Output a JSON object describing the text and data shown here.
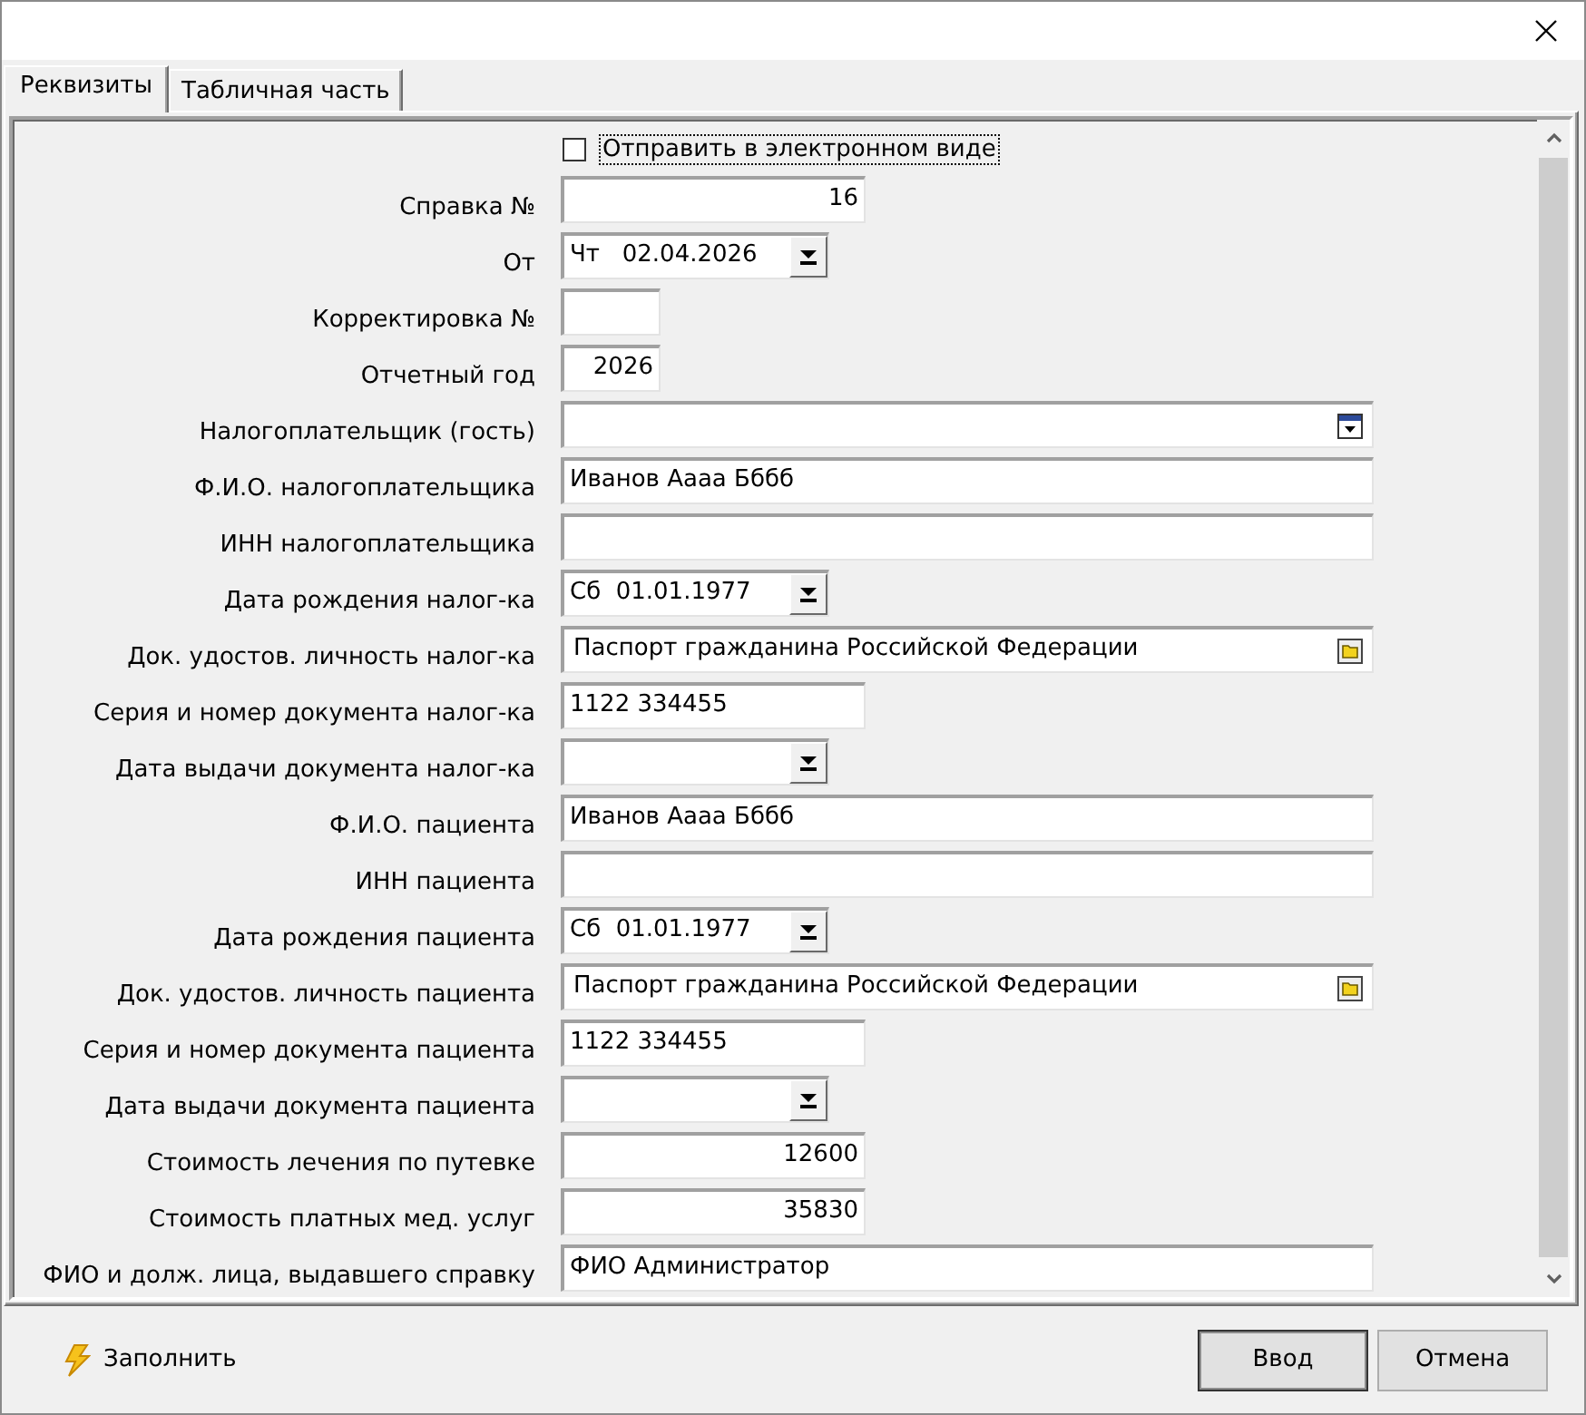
{
  "tabs": [
    {
      "label": "Реквизиты",
      "selected": true
    },
    {
      "label": "Табличная часть",
      "selected": false
    }
  ],
  "send_electronically": {
    "label": "Отправить в электронном виде",
    "checked": false,
    "focused": true
  },
  "fields": [
    {
      "label": "Справка №",
      "kind": "number",
      "value": "16"
    },
    {
      "label": "От",
      "kind": "date",
      "value": "Чт   02.04.2026"
    },
    {
      "label": "Корректировка №",
      "kind": "short"
    },
    {
      "label": "Отчетный год",
      "kind": "short",
      "value": "2026"
    },
    {
      "label": "Налогоплательщик (гость)",
      "kind": "lookup"
    },
    {
      "label": "Ф.И.О. налогоплательщика",
      "kind": "text",
      "value": "Иванов Аааа Бббб"
    },
    {
      "label": "ИНН налогоплательщика",
      "kind": "text"
    },
    {
      "label": "Дата рождения налог-ка",
      "kind": "date",
      "value": "Сб  01.01.1977"
    },
    {
      "label": "Док. удостов. личность налог-ка",
      "kind": "catalog",
      "value": "Паспорт гражданина Российской Федерации"
    },
    {
      "label": "Серия и номер документа налог-ка",
      "kind": "code",
      "value": "1122 334455"
    },
    {
      "label": "Дата выдачи документа налог-ка",
      "kind": "date"
    },
    {
      "label": "Ф.И.О. пациента",
      "kind": "text",
      "value": "Иванов Аааа Бббб"
    },
    {
      "label": "ИНН пациента",
      "kind": "text"
    },
    {
      "label": "Дата рождения пациента",
      "kind": "date",
      "value": "Сб  01.01.1977"
    },
    {
      "label": "Док. удостов. личность пациента",
      "kind": "catalog",
      "value": "Паспорт гражданина Российской Федерации"
    },
    {
      "label": "Серия и номер документа пациента",
      "kind": "code",
      "value": "1122 334455"
    },
    {
      "label": "Дата выдачи документа пациента",
      "kind": "date"
    },
    {
      "label": "Стоимость лечения по путевке",
      "kind": "number",
      "value": "12600"
    },
    {
      "label": "Стоимость платных мед. услуг",
      "kind": "number",
      "value": "35830"
    },
    {
      "label": "ФИО и долж. лица, выдавшего справку",
      "kind": "text",
      "value": "ФИО Администратор"
    }
  ],
  "fill_button": {
    "label": "Заполнить"
  },
  "buttons": [
    {
      "label": "Ввод",
      "default": true
    },
    {
      "label": "Отмена",
      "default": false
    }
  ]
}
